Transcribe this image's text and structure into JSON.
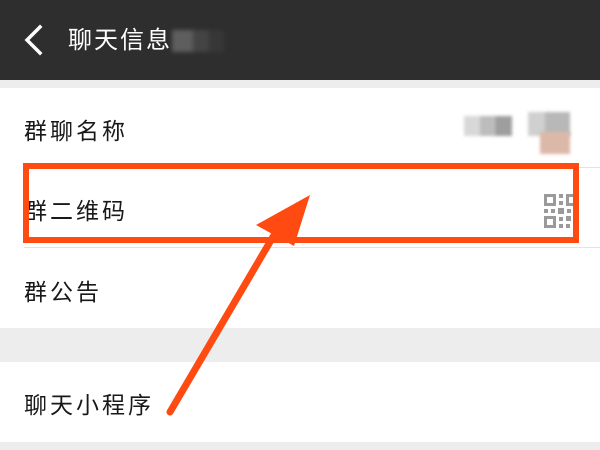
{
  "header": {
    "title": "聊天信息",
    "back_icon": "chevron-left-icon"
  },
  "settings": {
    "group_name_label": "群聊名称",
    "group_qr_label": "群二维码",
    "group_notice_label": "群公告",
    "mini_program_label": "聊天小程序"
  },
  "icons": {
    "qr": "qr-code-icon"
  },
  "colors": {
    "topbar_background": "#2e2e2e",
    "page_background": "#ededed",
    "row_background": "#ffffff",
    "annotation": "#ff4a12",
    "text": "#191919"
  }
}
